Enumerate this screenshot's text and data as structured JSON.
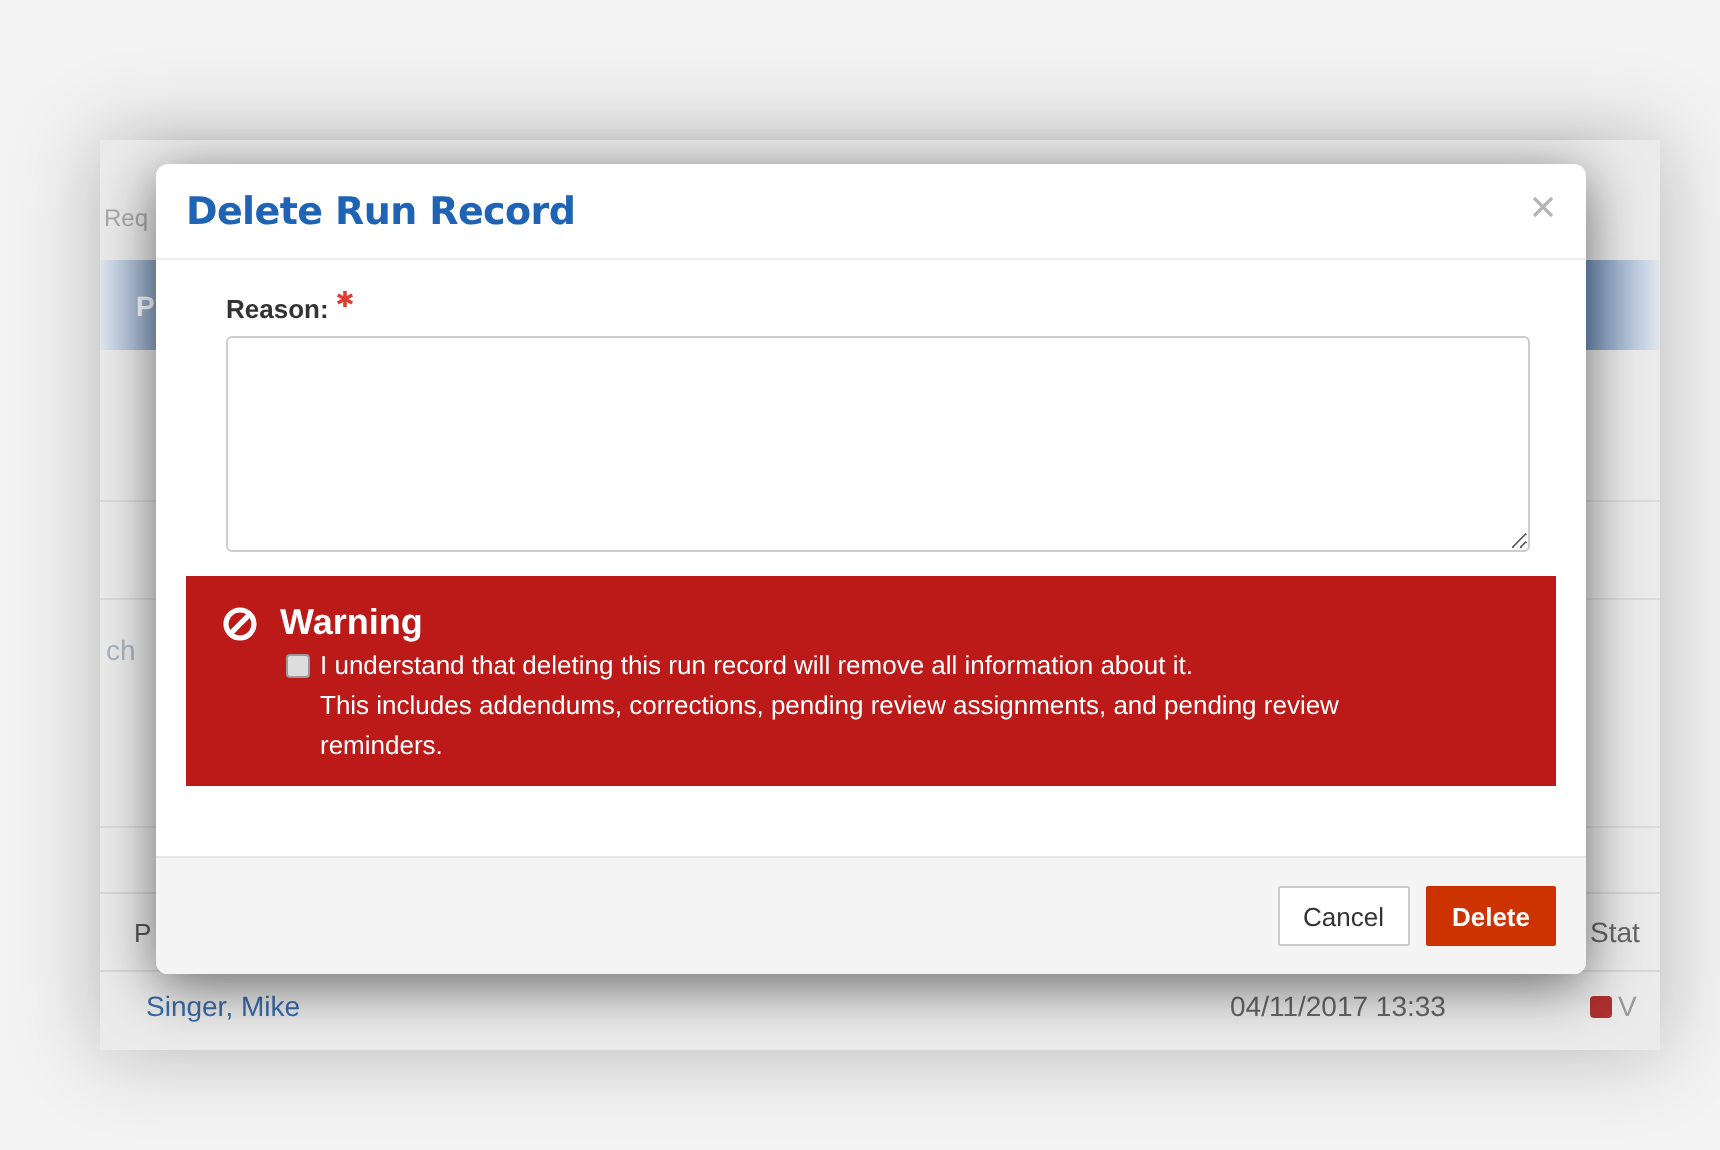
{
  "background_page": {
    "breadcrumb": "Req",
    "header_bar_text": "P",
    "search_label": "ch",
    "table": {
      "columns": [
        "P",
        "Stat"
      ],
      "rows": [
        {
          "name": "Singer, Mike",
          "date": "04/11/2017 13:33",
          "status": "V"
        }
      ]
    }
  },
  "dialog": {
    "title": "Delete Run Record",
    "reason": {
      "label": "Reason:",
      "required": true
    },
    "warning": {
      "title": "Warning",
      "acknowledge": {
        "checked": false,
        "text": "I understand that deleting this run record will remove all information about it."
      },
      "details": "This includes addendums, corrections, pending review assignments, and pending review reminders."
    },
    "buttons": [
      {
        "label": "Cancel",
        "kind": "secondary"
      },
      {
        "label": "Delete",
        "kind": "danger"
      }
    ]
  }
}
